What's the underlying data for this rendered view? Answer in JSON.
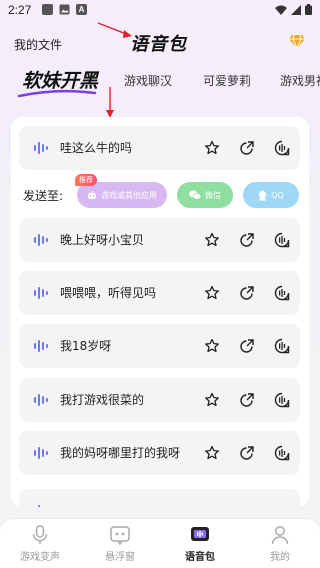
{
  "status_bar": {
    "time": "2:27",
    "left_icons": [
      "notification-icon",
      "image-icon",
      "a-icon"
    ],
    "right_icons": [
      "wifi-icon",
      "signal-icon",
      "battery-icon"
    ]
  },
  "header": {
    "mine_label": "我的文件",
    "title": "语音包",
    "gem_icon": "diamond-icon",
    "accent": "#f5a623"
  },
  "tabs": [
    {
      "label": "软妹开黑",
      "active": true
    },
    {
      "label": "游戏聊汉",
      "active": false
    },
    {
      "label": "可爱萝莉",
      "active": false
    },
    {
      "label": "游戏男神",
      "active": false
    }
  ],
  "items": [
    {
      "text": "哇这么牛的吗"
    },
    {
      "text": "晚上好呀小宝贝"
    },
    {
      "text": "喂喂喂，听得见吗"
    },
    {
      "text": "我18岁呀"
    },
    {
      "text": "我打游戏很菜的"
    },
    {
      "text": "我的妈呀哪里打的我呀"
    }
  ],
  "send_to": {
    "label": "发送至:",
    "badge": "推荐",
    "targets": [
      {
        "label": "游戏或其他应用",
        "color": "#d8b8f2"
      },
      {
        "label": "微信",
        "color": "#8fe0a0"
      },
      {
        "label": "QQ",
        "color": "#9fd7f7"
      }
    ]
  },
  "item_actions": [
    "star-icon",
    "share-icon",
    "voice-send-icon"
  ],
  "bottom_nav": [
    {
      "label": "游戏变声",
      "icon": "microphone-icon",
      "active": false
    },
    {
      "label": "悬浮窗",
      "icon": "float-window-icon",
      "active": false
    },
    {
      "label": "语音包",
      "icon": "voice-pack-icon",
      "active": true
    },
    {
      "label": "我的",
      "icon": "profile-icon",
      "active": false
    }
  ],
  "annotation_color": "#e0202a"
}
